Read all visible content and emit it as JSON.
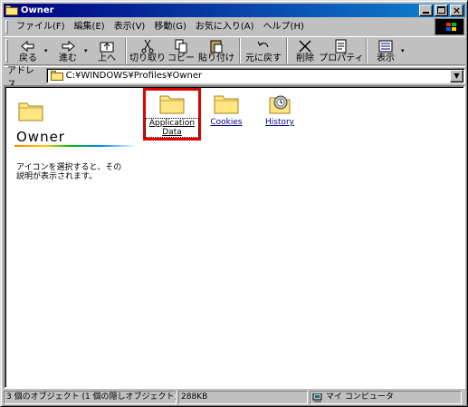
{
  "window": {
    "title": "Owner"
  },
  "menu": {
    "items": [
      {
        "label": "ファイル(F)"
      },
      {
        "label": "編集(E)"
      },
      {
        "label": "表示(V)"
      },
      {
        "label": "移動(G)"
      },
      {
        "label": "お気に入り(A)"
      },
      {
        "label": "ヘルプ(H)"
      }
    ]
  },
  "toolbar": {
    "back": "戻る",
    "forward": "進む",
    "up": "上へ",
    "cut": "切り取り",
    "copy": "コピー",
    "paste": "貼り付け",
    "undo": "元に戻す",
    "delete": "削除",
    "properties": "プロパティ",
    "views": "表示"
  },
  "address": {
    "label": "アドレス",
    "value": "C:¥WINDOWS¥Profiles¥Owner"
  },
  "info": {
    "title": "Owner",
    "description": "アイコンを選択すると、その説明が表示されます。"
  },
  "files": [
    {
      "name": "Application Data",
      "icon": "folder-icon",
      "selected": true
    },
    {
      "name": "Cookies",
      "icon": "folder-icon",
      "selected": false
    },
    {
      "name": "History",
      "icon": "history-folder-icon",
      "selected": false
    }
  ],
  "status": {
    "objects": "3 個のオブジェクト (1 個の隠しオブジェクト)",
    "size": "288KB",
    "zone": "マイ コンピュータ"
  },
  "colors": {
    "titlebar": "#000080",
    "highlight": "#e00000",
    "folder": "#ffe680"
  }
}
